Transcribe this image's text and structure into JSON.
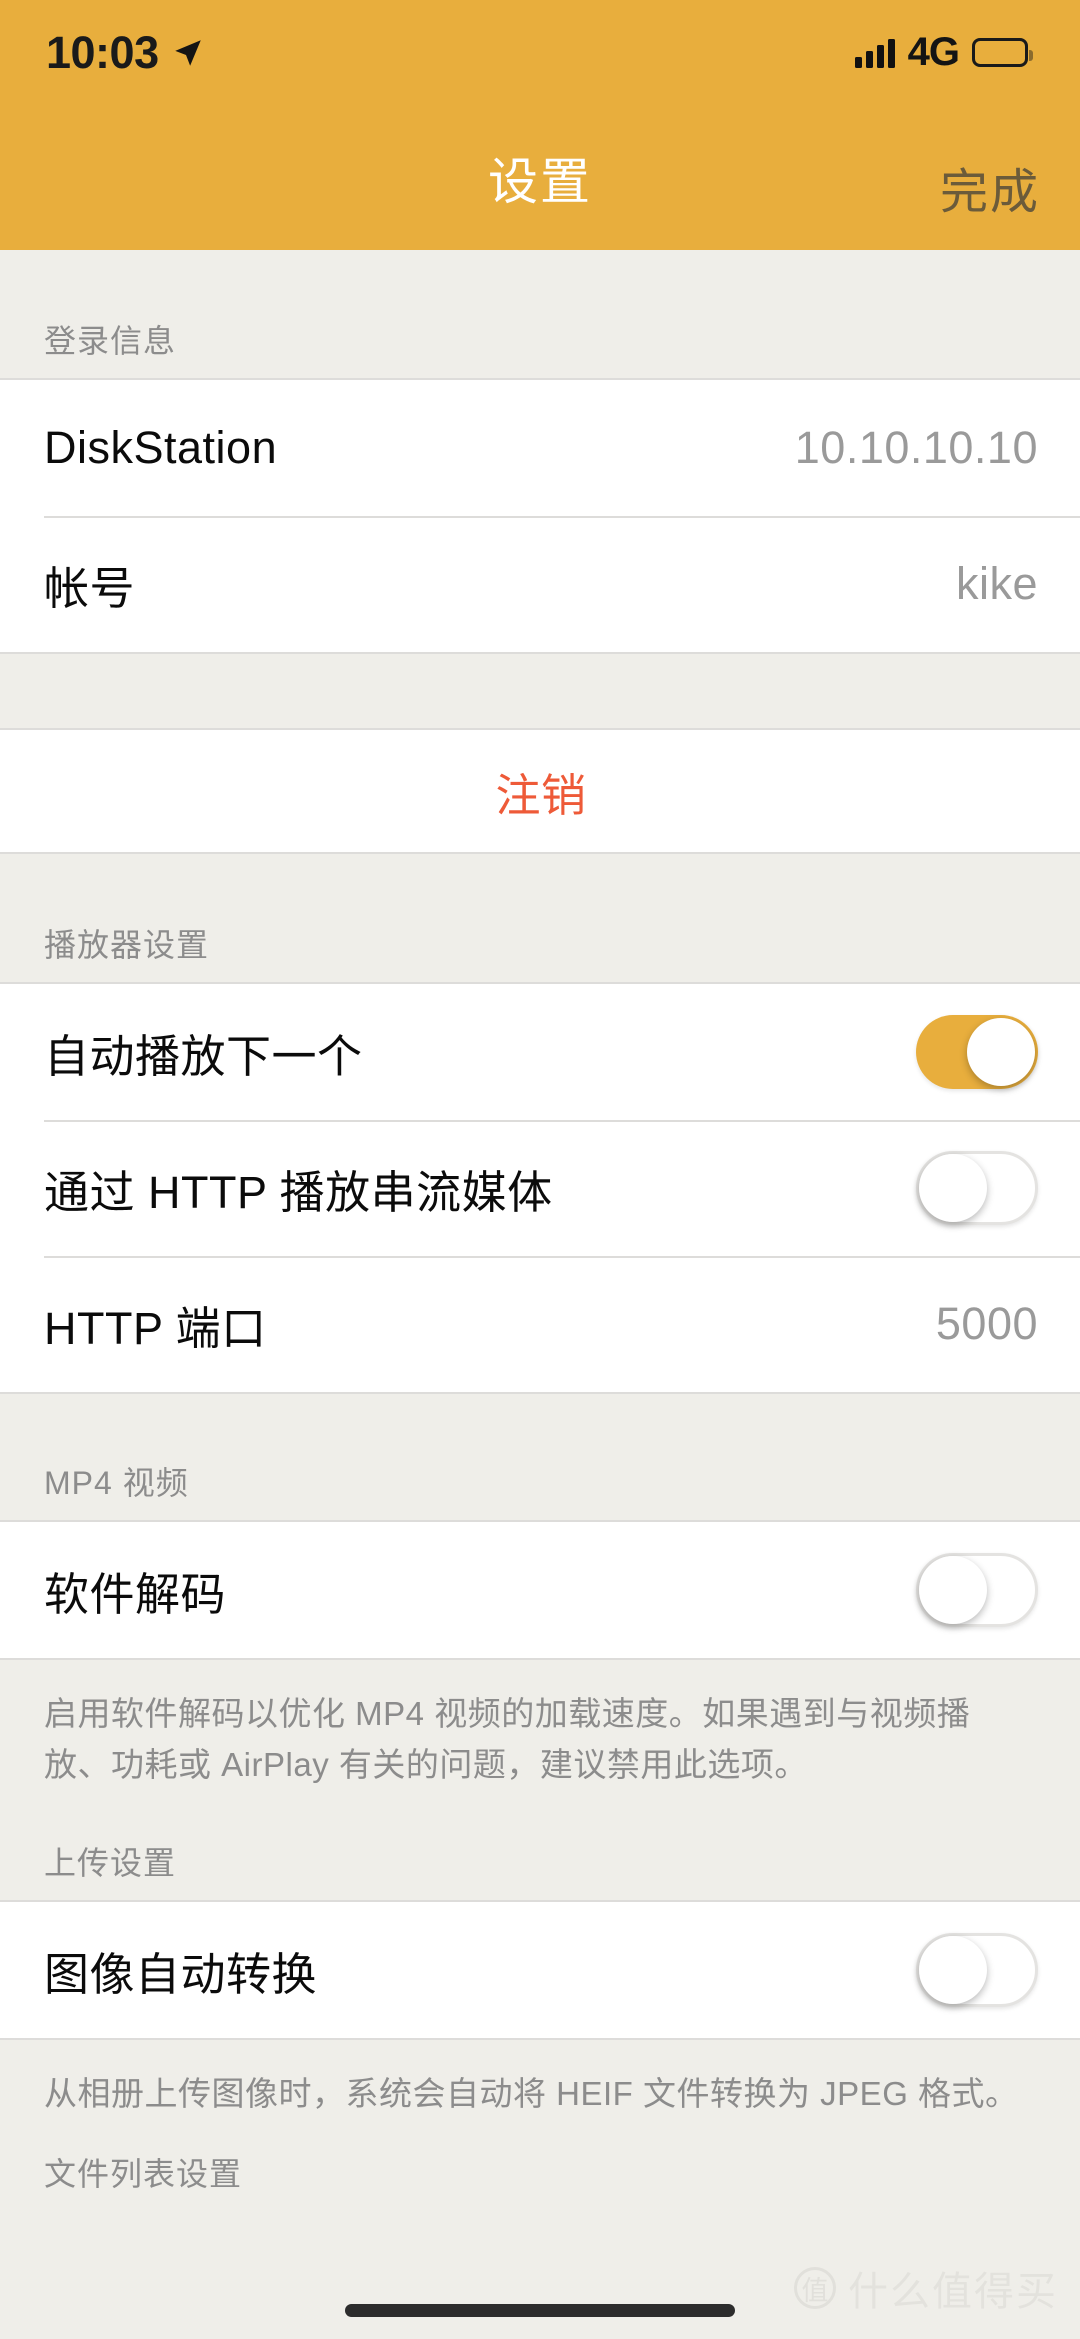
{
  "status_bar": {
    "time": "10:03",
    "location_icon": "location-arrow-icon",
    "signal_icon": "cellular-bars-icon",
    "network": "4G",
    "battery_icon": "battery-full-icon"
  },
  "nav_bar": {
    "title": "设置",
    "done_label": "完成"
  },
  "sections": [
    {
      "header": "登录信息",
      "rows": [
        {
          "label": "DiskStation",
          "value": "10.10.10.10"
        },
        {
          "label": "帐号",
          "value": "kike"
        }
      ]
    },
    {
      "header": "",
      "rows": [
        {
          "label": "注销"
        }
      ]
    },
    {
      "header": "播放器设置",
      "rows": [
        {
          "label": "自动播放下一个",
          "toggle": "on"
        },
        {
          "label": "通过 HTTP 播放串流媒体",
          "toggle": "off"
        },
        {
          "label": "HTTP 端口",
          "value": "5000"
        }
      ]
    },
    {
      "header": "MP4 视频",
      "rows": [
        {
          "label": "软件解码",
          "toggle": "off"
        }
      ],
      "footnote": "启用软件解码以优化 MP4 视频的加载速度。如果遇到与视频播放、功耗或 AirPlay 有关的问题，建议禁用此选项。"
    },
    {
      "header": "上传设置",
      "rows": [
        {
          "label": "图像自动转换",
          "toggle": "off"
        }
      ],
      "footnote": "从相册上传图像时，系统会自动将 HEIF 文件转换为 JPEG 格式。"
    },
    {
      "header": "文件列表设置",
      "rows": []
    }
  ],
  "colors": {
    "accent": "#E8AE3D",
    "destructive": "#EE5A38",
    "group_background": "#EFEEE9",
    "row_background": "#FFFFFF",
    "secondary_text": "#9A9A9A"
  },
  "watermark": {
    "badge": "值",
    "text": "什么值得买"
  }
}
